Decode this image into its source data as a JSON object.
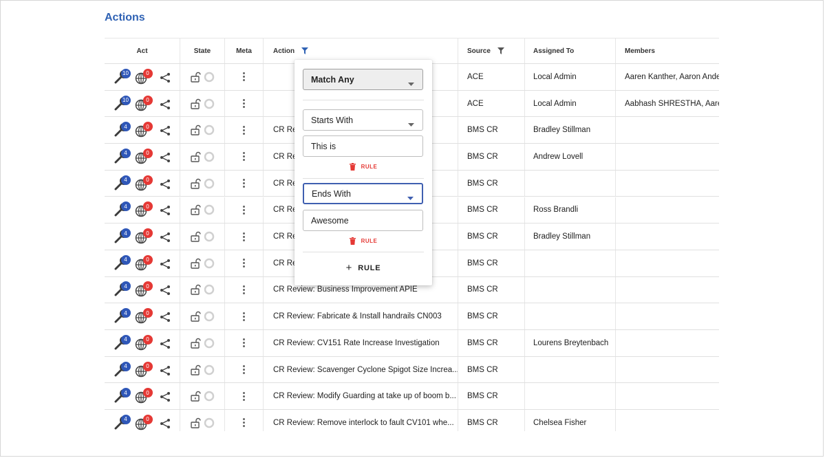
{
  "page": {
    "title": "Actions"
  },
  "columns": {
    "act": "Act",
    "state": "State",
    "meta": "Meta",
    "action": "Action",
    "source": "Source",
    "assigned": "Assigned To",
    "members": "Members"
  },
  "colors": {
    "accent": "#2f62b4",
    "badge_blue": "#2f57b8",
    "badge_red": "#e53935"
  },
  "rows": [
    {
      "blue": "10",
      "red": "0",
      "action": "",
      "source": "ACE",
      "assigned": "Local Admin",
      "members": "Aaren Kanther, Aaron Ander"
    },
    {
      "blue": "10",
      "red": "0",
      "action": "",
      "source": "ACE",
      "assigned": "Local Admin",
      "members": "Aabhash SHRESTHA, Aaren"
    },
    {
      "blue": "4",
      "red": "0",
      "action": "CR Re",
      "source": "BMS CR",
      "assigned": "Bradley Stillman",
      "members": ""
    },
    {
      "blue": "4",
      "red": "0",
      "action": "CR Re",
      "source": "BMS CR",
      "assigned": "Andrew Lovell",
      "members": ""
    },
    {
      "blue": "4",
      "red": "0",
      "action": "CR Re",
      "source": "BMS CR",
      "assigned": "",
      "members": ""
    },
    {
      "blue": "4",
      "red": "0",
      "action": "CR Re                                       ula...",
      "source": "BMS CR",
      "assigned": "Ross Brandli",
      "members": ""
    },
    {
      "blue": "4",
      "red": "0",
      "action": "CR Re",
      "source": "BMS CR",
      "assigned": "Bradley Stillman",
      "members": ""
    },
    {
      "blue": "4",
      "red": "0",
      "action": "CR Re",
      "source": "BMS CR",
      "assigned": "",
      "members": ""
    },
    {
      "blue": "4",
      "red": "0",
      "action": "CR Review: Business Improvement APIE",
      "source": "BMS CR",
      "assigned": "",
      "members": ""
    },
    {
      "blue": "4",
      "red": "0",
      "action": "CR Review: Fabricate & Install handrails CN003",
      "source": "BMS CR",
      "assigned": "",
      "members": ""
    },
    {
      "blue": "4",
      "red": "0",
      "action": "CR Review: CV151 Rate Increase Investigation",
      "source": "BMS CR",
      "assigned": "Lourens Breytenbach",
      "members": ""
    },
    {
      "blue": "4",
      "red": "0",
      "action": "CR Review: Scavenger Cyclone Spigot Size Increa...",
      "source": "BMS CR",
      "assigned": "",
      "members": ""
    },
    {
      "blue": "4",
      "red": "0",
      "action": "CR Review: Modify Guarding at take up of boom b...",
      "source": "BMS CR",
      "assigned": "",
      "members": ""
    },
    {
      "blue": "4",
      "red": "0",
      "action": "CR Review: Remove interlock to fault CV101 whe...",
      "source": "BMS CR",
      "assigned": "Chelsea Fisher",
      "members": ""
    }
  ],
  "filter": {
    "match_mode": "Match Any",
    "rules": [
      {
        "operator": "Starts With",
        "value": "This is",
        "delete_label": "RULE"
      },
      {
        "operator": "Ends With",
        "value": "Awesome",
        "delete_label": "RULE"
      }
    ],
    "add_rule_label": "RULE",
    "add_rule_plus": "+"
  }
}
